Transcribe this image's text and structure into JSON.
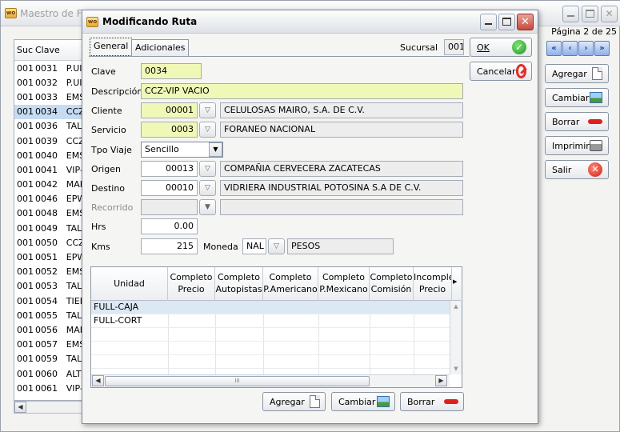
{
  "back_window": {
    "title": "Maestro de F",
    "grid": {
      "col_suc": "Suc",
      "col_clave": "Clave",
      "rows": [
        {
          "suc": "001",
          "clave": "0031",
          "desc": "P.UI"
        },
        {
          "suc": "001",
          "clave": "0032",
          "desc": "P.UI"
        },
        {
          "suc": "001",
          "clave": "0033",
          "desc": "EMS"
        },
        {
          "suc": "001",
          "clave": "0034",
          "desc": "CCZ"
        },
        {
          "suc": "001",
          "clave": "0036",
          "desc": "TAL"
        },
        {
          "suc": "001",
          "clave": "0039",
          "desc": "CCZ"
        },
        {
          "suc": "001",
          "clave": "0040",
          "desc": "EMS"
        },
        {
          "suc": "001",
          "clave": "0041",
          "desc": "VIP-"
        },
        {
          "suc": "001",
          "clave": "0042",
          "desc": "MAII"
        },
        {
          "suc": "001",
          "clave": "0046",
          "desc": "EPW"
        },
        {
          "suc": "001",
          "clave": "0048",
          "desc": "EMS"
        },
        {
          "suc": "001",
          "clave": "0049",
          "desc": "TAL"
        },
        {
          "suc": "001",
          "clave": "0050",
          "desc": "CCZ"
        },
        {
          "suc": "001",
          "clave": "0051",
          "desc": "EPW"
        },
        {
          "suc": "001",
          "clave": "0052",
          "desc": "EMS"
        },
        {
          "suc": "001",
          "clave": "0053",
          "desc": "TAL"
        },
        {
          "suc": "001",
          "clave": "0054",
          "desc": "TIEF"
        },
        {
          "suc": "001",
          "clave": "0055",
          "desc": "TAL"
        },
        {
          "suc": "001",
          "clave": "0056",
          "desc": "MAII"
        },
        {
          "suc": "001",
          "clave": "0057",
          "desc": "EMS"
        },
        {
          "suc": "001",
          "clave": "0059",
          "desc": "TAL"
        },
        {
          "suc": "001",
          "clave": "0060",
          "desc": "ALT/"
        },
        {
          "suc": "001",
          "clave": "0061",
          "desc": "VIP-"
        }
      ],
      "selected_index": 3
    },
    "pager": "Página 2 de 25",
    "buttons": {
      "agregar": "Agregar",
      "cambiar": "Cambiar",
      "borrar": "Borrar",
      "imprimir": "Imprimir",
      "salir": "Salir"
    }
  },
  "dialog": {
    "title": "Modificando Ruta",
    "tabs": [
      "General",
      "Adicionales"
    ],
    "active_tab": 0,
    "sucursal_label": "Sucursal",
    "sucursal_value": "001",
    "ok_label": "OK",
    "cancel_label": "Cancelar",
    "fields": {
      "clave_label": "Clave",
      "clave": "0034",
      "descripcion_label": "Descripción",
      "descripcion": "CCZ-VIP VACIO",
      "cliente_label": "Cliente",
      "cliente_code": "00001",
      "cliente_name": "CELULOSAS MAIRO, S.A. DE C.V.",
      "servicio_label": "Servicio",
      "servicio_code": "0003",
      "servicio_name": "FORANEO NACIONAL",
      "tipo_viaje_label": "Tpo Viaje",
      "tipo_viaje": "Sencillo",
      "origen_label": "Origen",
      "origen_code": "00013",
      "origen_name": "COMPAÑIA CERVECERA ZACATECAS",
      "destino_label": "Destino",
      "destino_code": "00010",
      "destino_name": "VIDRIERA INDUSTRIAL POTOSINA S.A DE C.V.",
      "recorrido_label": "Recorrido",
      "recorrido_code": "",
      "recorrido_name": "",
      "hrs_label": "Hrs",
      "hrs": "0.00",
      "kms_label": "Kms",
      "kms": "215",
      "moneda_label": "Moneda",
      "moneda_code": "NAL",
      "moneda_name": "PESOS"
    },
    "grid": {
      "headers": [
        "Unidad",
        "Completo\nPrecio",
        "Completo\nAutopistas",
        "Completo\nP.Americano",
        "Completo\nP.Mexicano",
        "Completo\nComisión",
        "Incomple\nPrecio"
      ],
      "rows": [
        "FULL-CAJA",
        "FULL-CORT"
      ],
      "scroll_mark": "III"
    },
    "bottom_buttons": {
      "agregar": "Agregar",
      "cambiar": "Cambiar",
      "borrar": "Borrar"
    }
  }
}
